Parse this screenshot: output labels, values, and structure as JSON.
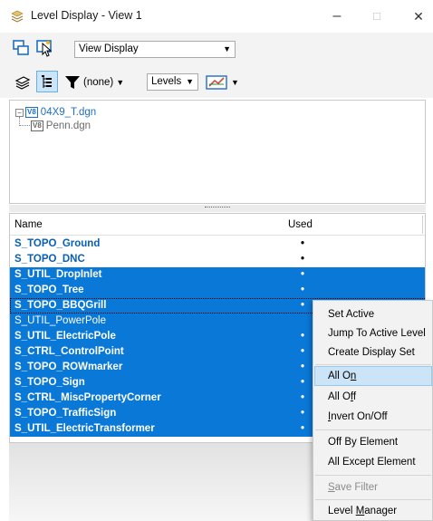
{
  "window": {
    "title": "Level Display - View 1",
    "controls": {
      "minimize": "–",
      "maximize": "□",
      "close": "✕"
    }
  },
  "toolbar": {
    "view_select": {
      "value": "View Display"
    },
    "filter": {
      "value": "(none)"
    },
    "levels_combo": {
      "value": "Levels"
    }
  },
  "tree": {
    "root": {
      "label": "04X9_T.dgn",
      "badge": "V8"
    },
    "child": {
      "label": "Penn.dgn",
      "badge": "V8"
    }
  },
  "list": {
    "columns": {
      "name": "Name",
      "used": "Used"
    },
    "rows": [
      {
        "name": "S_TOPO_Ground",
        "used": "•",
        "state": "plain"
      },
      {
        "name": "S_TOPO_DNC",
        "used": "•",
        "state": "plain"
      },
      {
        "name": "S_UTIL_DropInlet",
        "used": "•",
        "state": "sel"
      },
      {
        "name": "S_TOPO_Tree",
        "used": "•",
        "state": "sel"
      },
      {
        "name": "S_TOPO_BBQGrill",
        "used": "•",
        "state": "sel-focused"
      },
      {
        "name": "S_UTIL_PowerPole",
        "used": "",
        "state": "sel-off"
      },
      {
        "name": "S_UTIL_ElectricPole",
        "used": "•",
        "state": "sel"
      },
      {
        "name": "S_CTRL_ControlPoint",
        "used": "•",
        "state": "sel"
      },
      {
        "name": "S_TOPO_ROWmarker",
        "used": "•",
        "state": "sel"
      },
      {
        "name": "S_TOPO_Sign",
        "used": "•",
        "state": "sel"
      },
      {
        "name": "S_CTRL_MiscPropertyCorner",
        "used": "•",
        "state": "sel"
      },
      {
        "name": "S_TOPO_TrafficSign",
        "used": "•",
        "state": "sel"
      },
      {
        "name": "S_UTIL_ElectricTransformer",
        "used": "•",
        "state": "sel"
      }
    ]
  },
  "context_menu": {
    "items": [
      {
        "label": "Set Active"
      },
      {
        "label": "Jump To Active Level"
      },
      {
        "label": "Create Display Set"
      },
      {
        "label": "All On",
        "highlighted": true
      },
      {
        "label": "All Off"
      },
      {
        "label": "Invert On/Off"
      },
      {
        "label": "Off By Element"
      },
      {
        "label": "All Except Element"
      },
      {
        "label": "Save Filter",
        "disabled": true
      },
      {
        "label": "Level Manager"
      }
    ]
  },
  "colors": {
    "selection": "#0a78d7",
    "level_text": "#0a5fb5",
    "menu_hover": "#cce4f7"
  }
}
